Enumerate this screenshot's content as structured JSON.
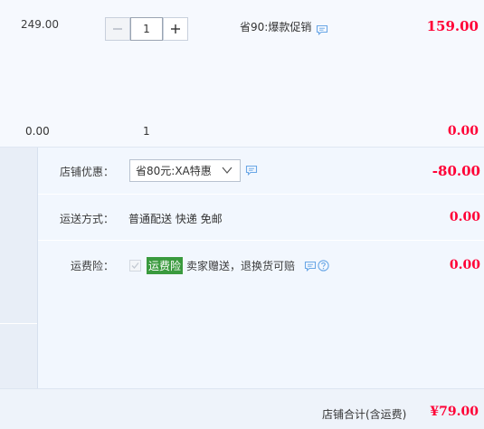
{
  "item": {
    "original_price": "249.00",
    "quantity": "1",
    "promo_text": "省90:爆款促销",
    "item_price": "159.00"
  },
  "subtotal": {
    "left_value": "0.00",
    "quantity": "1",
    "amount": "0.00"
  },
  "shop_discount": {
    "label": "店铺优惠：",
    "selected_option": "省80元:XA特惠",
    "amount": "-80.00"
  },
  "shipping": {
    "label": "运送方式：",
    "method_text": "普通配送 快递 免邮",
    "amount": "0.00"
  },
  "shipping_insurance": {
    "label": "运费险：",
    "badge": "运费险",
    "description": "卖家赠送，退换货可赔",
    "amount": "0.00"
  },
  "footer": {
    "total_label": "店铺合计(含运费)",
    "total_value": "¥79.00"
  },
  "colors": {
    "price_red": "#ff0036",
    "insurance_green": "#3a9a3e",
    "icon_blue": "#6aa7e6"
  },
  "icons": [
    "minus-icon",
    "plus-icon",
    "chat-icon",
    "chevron-down-icon",
    "checkmark-icon",
    "help-icon"
  ]
}
